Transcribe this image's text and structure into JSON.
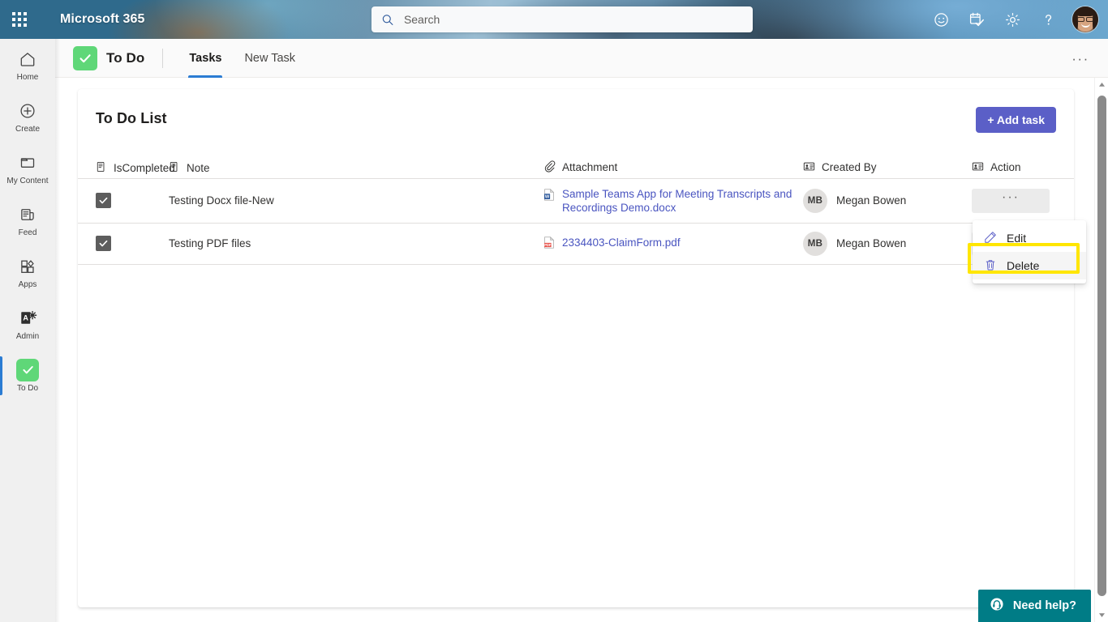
{
  "suite": {
    "brand": "Microsoft 365",
    "waffle_icon": "app-launcher-icon",
    "search": {
      "placeholder": "Search",
      "value": "",
      "icon": "search-icon"
    },
    "icons": [
      {
        "name": "feedback-smiley-icon",
        "label": "Feedback"
      },
      {
        "name": "calendar-check-icon",
        "label": "Tasks"
      },
      {
        "name": "gear-icon",
        "label": "Settings"
      },
      {
        "name": "help-question-icon",
        "label": "Help"
      }
    ],
    "avatar": {
      "name": "user-avatar",
      "label": "Account manager"
    }
  },
  "rail": {
    "items": [
      {
        "label": "Home",
        "icon": "home-icon",
        "selected": false
      },
      {
        "label": "Create",
        "icon": "plus-circle-icon",
        "selected": false
      },
      {
        "label": "My Content",
        "icon": "folder-icon",
        "selected": false
      },
      {
        "label": "Feed",
        "icon": "feed-icon",
        "selected": false
      },
      {
        "label": "Apps",
        "icon": "apps-grid-icon",
        "selected": false
      },
      {
        "label": "Admin",
        "icon": "admin-icon",
        "selected": false
      },
      {
        "label": "To Do",
        "icon": "checkmark-tile-icon",
        "selected": true
      }
    ]
  },
  "app_bar": {
    "logo_icon": "checkmark-icon",
    "title": "To Do",
    "tabs": [
      {
        "label": "Tasks",
        "active": true
      },
      {
        "label": "New Task",
        "active": false
      }
    ],
    "more_label": "···"
  },
  "card": {
    "title": "To Do List",
    "add_task_label": "+ Add task",
    "columns": [
      {
        "label": "IsCompleted",
        "icon": "note-doc-icon"
      },
      {
        "label": "Note",
        "icon": "note-doc-icon"
      },
      {
        "label": "Attachment",
        "icon": "paperclip-icon"
      },
      {
        "label": "Created By",
        "icon": "contact-card-icon"
      },
      {
        "label": "Action",
        "icon": "contact-card-icon"
      }
    ],
    "rows": [
      {
        "is_completed": true,
        "note": "Testing Docx file-New",
        "attachment": "Sample Teams App for Meeting Transcripts and Recordings Demo.docx",
        "attachment_type": "word",
        "created_by": "Megan Bowen",
        "initials": "MB",
        "action_label": "···"
      },
      {
        "is_completed": true,
        "note": "Testing PDF files",
        "attachment": "2334403-ClaimForm.pdf",
        "attachment_type": "pdf",
        "created_by": "Megan Bowen",
        "initials": "MB",
        "action_label": "···"
      }
    ]
  },
  "context_menu": {
    "items": [
      {
        "label": "Edit",
        "icon": "pencil-icon",
        "highlighted": false
      },
      {
        "label": "Delete",
        "icon": "trash-icon",
        "highlighted": true
      }
    ],
    "highlight_color": "#ffe600"
  },
  "need_help": {
    "label": "Need help?",
    "icon": "headset-icon",
    "color": "#007c86"
  },
  "colors": {
    "accent_purple": "#5b5fc7",
    "accent_blue": "#2b7cd3",
    "todo_green": "#5fd778",
    "link": "#4a55c0",
    "help_teal": "#007c86",
    "highlight_yellow": "#ffe600"
  },
  "scrollbar": {
    "up_icon": "caret-up-icon",
    "down_icon": "caret-down-icon"
  }
}
